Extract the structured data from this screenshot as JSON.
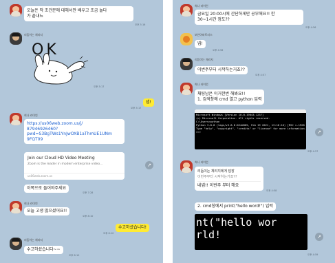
{
  "left": {
    "messages": [
      {
        "sender": "",
        "text1": "오늘은 딱 조건문에 대해서만 배우고 조금 놀다",
        "text2": "가 끝내뇨",
        "time": "오후 5:16"
      },
      {
        "sender": "리듬이는 체리지",
        "sticker_text": "OK",
        "time": "오후 5:17"
      },
      {
        "mine": "넵!",
        "time": "오후 5:17"
      },
      {
        "sender": "희나 라이언",
        "link1": "https://us06web.zoom.us/j/",
        "link2": "87946926460?",
        "link3": "pwd=S3BgTWs1YnJwOXB1aThmUE1UNm",
        "link4": "9FQT09",
        "time": "오후 5:17"
      },
      {
        "card_title": "Join our Cloud HD Video Meeting",
        "card_desc": "Zoom is the leader in modern enterprise video...",
        "card_domain": "us06web.zoom.us"
      },
      {
        "text": "이쪽으로 들어와주세요",
        "time": "오후 7:28"
      },
      {
        "sender": "희나 라이언",
        "text": "오늘 고생 많으셨어요!!",
        "time": "오후 8:10"
      },
      {
        "mine": "수고하셨습니다!",
        "time": "오후 8:10"
      },
      {
        "sender": "리듬이는 체리지",
        "text": "수고하셨습니다~~",
        "time": "오후 8:10"
      }
    ]
  },
  "right": {
    "messages": [
      {
        "sender": "희나 라이언",
        "text1": "금요일 20:00시에 간단하게만 공부해요!! 한",
        "text2": "30~1시간 정도??",
        "time": "오후 4:56"
      },
      {
        "sender": "보안아파트리스",
        "text": "넵!",
        "time": "오후 4:56"
      },
      {
        "sender": "리듬이는 체리지",
        "text": "이번주부터 시작하는거죠??",
        "time": "오후 4:57"
      },
      {
        "sender": "희나 라이언",
        "text1": "채팅남은 이거한번 해봐요!!",
        "text2": "1. 검색창에 cmd 열고 python 입력",
        "time": "오후 4:57"
      },
      {
        "terminal_lines": [
          "Microsoft Windows [Version 10.0.19043.1237]",
          "(c) Microsoft Corporation. All rights reserved.",
          "",
          "C:\\Users>python",
          "Python 3.8.8 (tags/v3.8.8:024d805, Feb 19 2021, 13:18:16) [MSC v.1928 64 bit (AMD64)] on win32",
          "Type \"help\", \"copyright\", \"credits\" or \"license\" for more information.",
          ">>>"
        ],
        "time": "오후 4:57"
      },
      {
        "sender": "희나 라이언",
        "text1": "리듬이는 체리지에게 답장",
        "text2": "이번주부터 시작하는거죠??",
        "text3": "네넵!! 이번주 부터 해요",
        "time": "오후 4:58"
      },
      {
        "text": "2. cmd창에서 print(\"hello word!\") 입력",
        "time": "오후 4:58"
      },
      {
        "code1": "nt(\"hello wor",
        "code2": "rld!",
        "time": "오후 4:59"
      }
    ]
  },
  "icons": {
    "share": "share-icon"
  },
  "colors": {
    "chat_bg": "#b2c7da",
    "my_bubble": "#ffeb33",
    "link": "#1a5fd0"
  }
}
